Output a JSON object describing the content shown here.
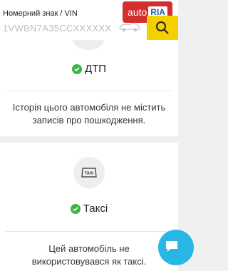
{
  "header": {
    "vin_label": "Номерний знак / VIN",
    "vin_placeholder": "1VWBN7A35CCXXXXXX",
    "brand_text": "auto",
    "brand_badge": "RIA",
    "accent": "#f4d000",
    "brand_color": "#d32f2f"
  },
  "dtp": {
    "title": "ДТП",
    "description": "Історія цього автомобіля не містить записів про пошкодження."
  },
  "taxi": {
    "icon_label": "TAXI",
    "title": "Таксі",
    "description": "Цей автомобіль не використовувався як таксі."
  },
  "icons": {
    "check": "check-circle-icon",
    "car": "car-icon",
    "search": "search-icon",
    "taxi": "taxi-icon",
    "chat": "chat-icon"
  },
  "colors": {
    "success": "#3cb546",
    "chat": "#29b6e6"
  }
}
